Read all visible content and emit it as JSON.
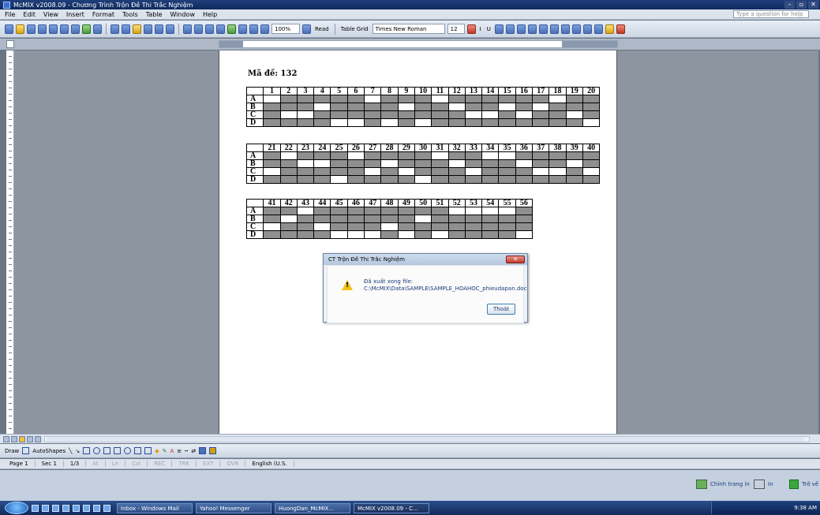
{
  "window": {
    "title": "McMIX v2008.09 - Chương Trình Trộn Đề Thi Trắc Nghiệm"
  },
  "menu": [
    "File",
    "Edit",
    "View",
    "Insert",
    "Format",
    "Tools",
    "Table",
    "Window",
    "Help"
  ],
  "help_box": "Type a question for help",
  "toolbar": {
    "zoom": "100%",
    "read": "Read",
    "table_grid": "Table Grid",
    "font": "Times New Roman",
    "size": "12",
    "bold": "B",
    "italic": "I",
    "underline": "U"
  },
  "document": {
    "ma_de": "Mã đề: 132",
    "tables": [
      {
        "nums": [
          "1",
          "2",
          "3",
          "4",
          "5",
          "6",
          "7",
          "8",
          "9",
          "10",
          "11",
          "12",
          "13",
          "14",
          "15",
          "16",
          "17",
          "18",
          "19",
          "20"
        ],
        "answers": [
          "A",
          "C",
          "C",
          "B",
          "D",
          "D",
          "A",
          "D",
          "B",
          "D",
          "A",
          "B",
          "C",
          "C",
          "B",
          "C",
          "B",
          "A",
          "C",
          "D"
        ]
      },
      {
        "nums": [
          "21",
          "22",
          "23",
          "24",
          "25",
          "26",
          "27",
          "28",
          "29",
          "30",
          "31",
          "32",
          "33",
          "34",
          "35",
          "36",
          "37",
          "38",
          "39",
          "40"
        ],
        "answers": [
          "C",
          "A",
          "B",
          "B",
          "D",
          "A",
          "C",
          "B",
          "C",
          "D",
          "A",
          "B",
          "C",
          "A",
          "A",
          "B",
          "C",
          "C",
          "B",
          "C"
        ]
      },
      {
        "nums": [
          "41",
          "42",
          "43",
          "44",
          "45",
          "46",
          "47",
          "48",
          "49",
          "50",
          "51",
          "52",
          "53",
          "54",
          "55",
          "56"
        ],
        "answers": [
          "C",
          "B",
          "A",
          "C",
          "D",
          "D",
          "D",
          "C",
          "D",
          "B",
          "D",
          "A",
          "A",
          "A",
          "A",
          "D"
        ]
      }
    ],
    "row_labels": [
      "A",
      "B",
      "C",
      "D"
    ]
  },
  "dialog": {
    "title": "CT Trộn Đề Thi Trắc Nghiệm",
    "close": "Close",
    "message_line1": "Đã xuất xong file:",
    "message_line2": "C:\\McMIX\\Data\\SAMPLE\\SAMPLE_HOAHOC_phieudapan.doc",
    "ok": "Thoát"
  },
  "drawbar": {
    "draw": "Draw",
    "autoshapes": "AutoShapes"
  },
  "status": {
    "page": "Page 1",
    "sec": "Sec 1",
    "pages": "1/3",
    "at": "At",
    "ln": "Ln",
    "col": "Col",
    "rec": "REC",
    "trk": "TRK",
    "ext": "EXT",
    "ovr": "OVR",
    "lang": "English (U.S."
  },
  "lower": {
    "b1": "Chỉnh trang in",
    "b2": "In",
    "b3": "Trở về"
  },
  "taskbar": {
    "tasks": [
      "Inbox - Windows Mail",
      "Yahoo! Messenger",
      "HuongDan_McMIX...",
      "McMIX v2008.09 - C..."
    ],
    "clock": "9:38 AM"
  },
  "colors": {
    "answer_white": "#ffffff",
    "answer_gray": "#8f8f8f",
    "titlebar": "#1f3e7a"
  }
}
